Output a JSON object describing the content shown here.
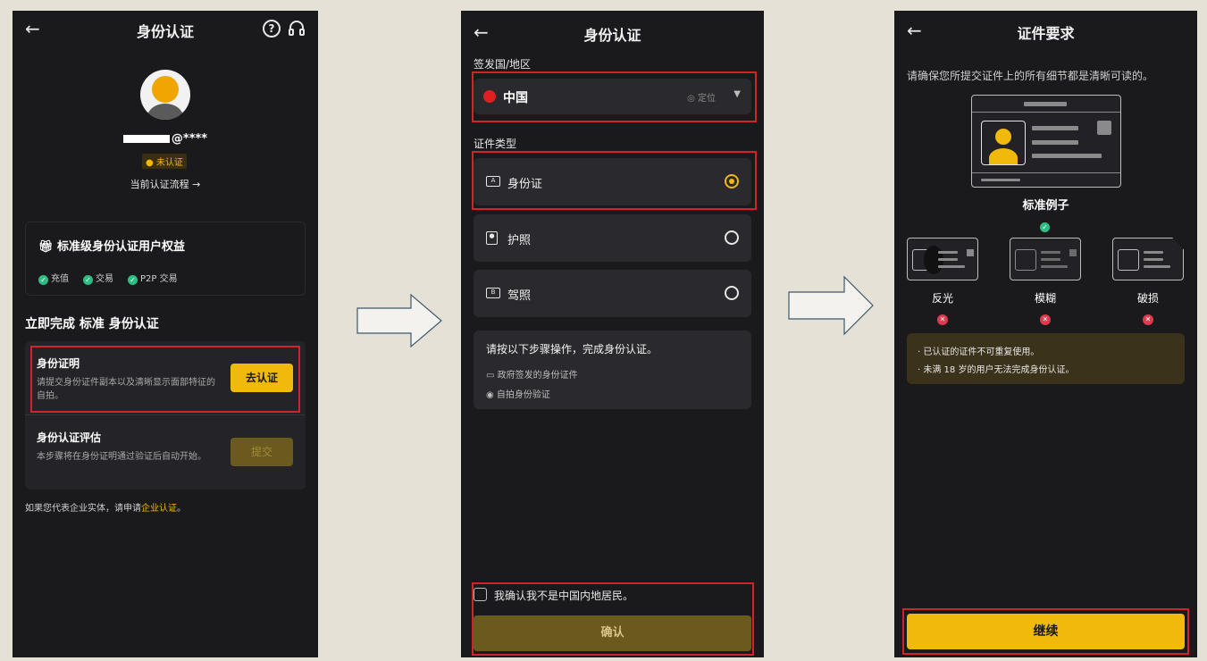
{
  "panel1": {
    "title": "身份认证",
    "back_icon": "←",
    "help_icon": "?",
    "headset_icon": "headset",
    "email_suffix": "@****",
    "status_badge": "未认证",
    "flow_link": "当前认证流程 →",
    "benefits": {
      "title": "标准级身份认证用户权益",
      "items": [
        "充值",
        "交易",
        "P2P 交易"
      ]
    },
    "section_title": "立即完成 标准 身份认证",
    "step1": {
      "title": "身份证明",
      "desc": "请提交身份证件副本以及清晰显示面部特征的自拍。",
      "button": "去认证"
    },
    "step2": {
      "title": "身份认证评估",
      "desc": "本步骤将在身份证明通过验证后自动开始。",
      "button": "提交"
    },
    "footer_text": "如果您代表企业实体，请申请",
    "footer_link": "企业认证",
    "footer_end": "。"
  },
  "panel2": {
    "title": "身份认证",
    "country_label": "签发国/地区",
    "country_value": "中国",
    "locate_label": "定位",
    "doc_type_label": "证件类型",
    "doc_options": [
      {
        "label": "身份证",
        "selected": true
      },
      {
        "label": "护照",
        "selected": false
      },
      {
        "label": "驾照",
        "selected": false
      }
    ],
    "steps_title": "请按以下步骤操作，完成身份认证。",
    "steps": [
      "政府签发的身份证件",
      "自拍身份验证"
    ],
    "confirm_checkbox": "我确认我不是中国内地居民。",
    "confirm_button": "确认"
  },
  "panel3": {
    "title": "证件要求",
    "intro": "请确保您所提交证件上的所有细节都是清晰可读的。",
    "standard_label": "标准例子",
    "bad_examples": [
      "反光",
      "模糊",
      "破损"
    ],
    "notes": [
      "· 已认证的证件不可重复使用。",
      "· 未满 18 岁的用户无法完成身份认证。"
    ],
    "continue_button": "继续"
  },
  "colors": {
    "accent": "#f0b90b",
    "highlight": "#d2232a",
    "success": "#2ebd85",
    "error": "#e2384d",
    "background": "#1a1a1c"
  }
}
